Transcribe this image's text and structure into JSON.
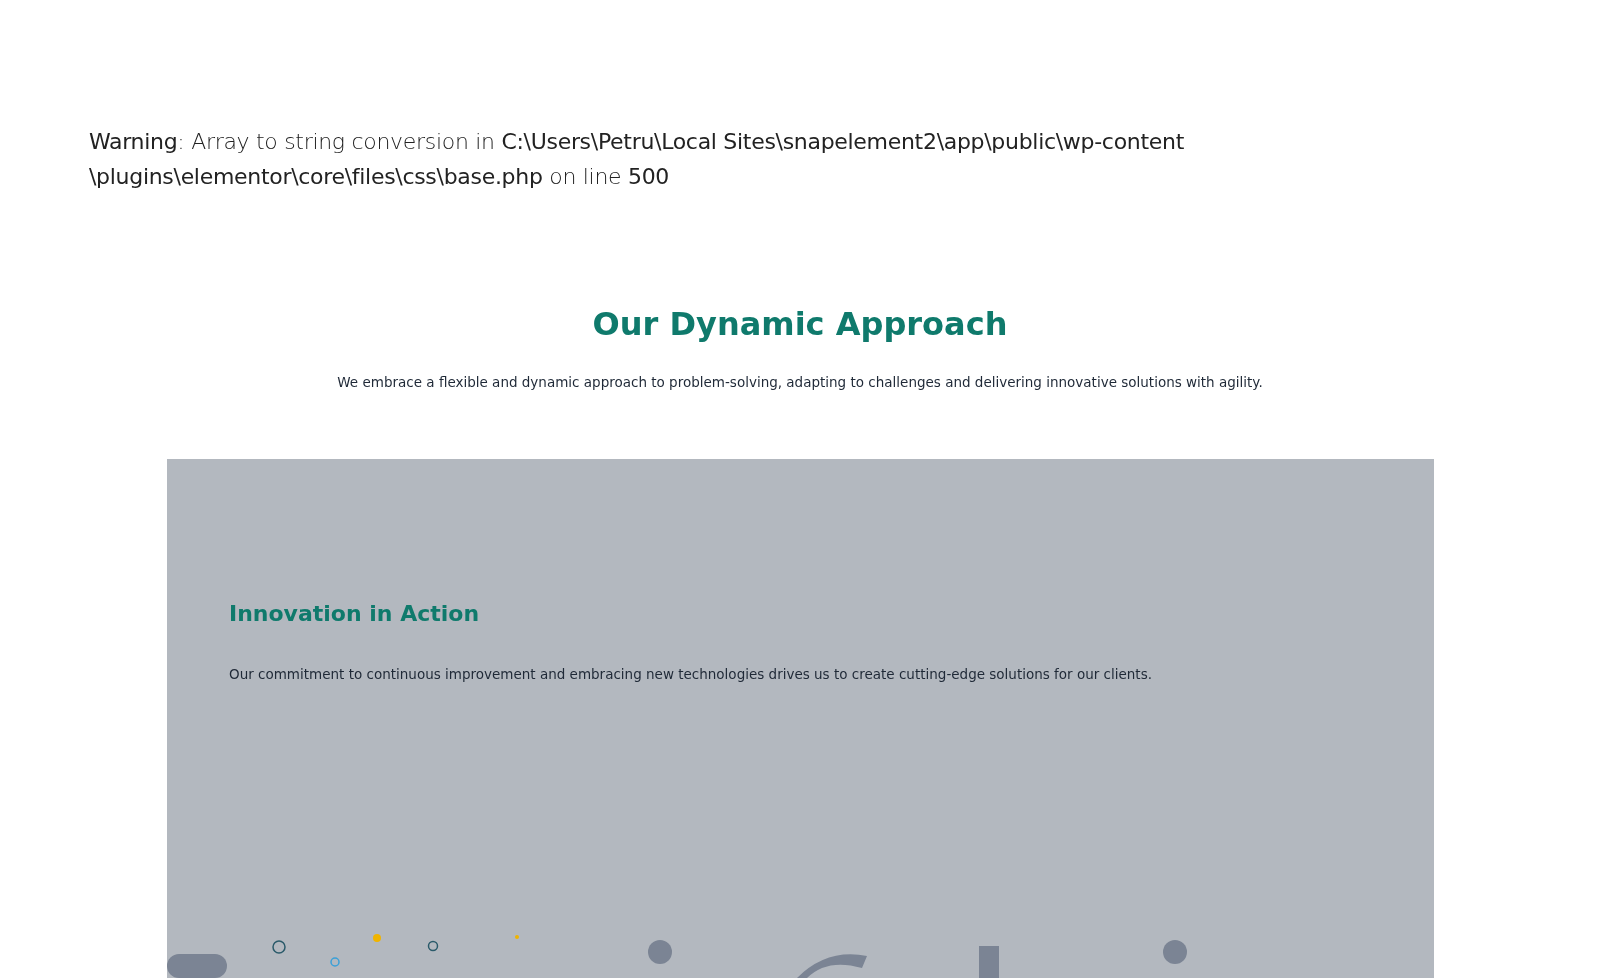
{
  "warning": "**Warning**: Array to string conversion in **C:\\Users\\Petru\\Local Sites\\snapelement2\\app\\public\\wp-content\\plugins\\elementor\\core\\files\\css\\base.php** on line **500**",
  "section": {
    "title": "Our Dynamic Approach",
    "subtitle": "We embrace a flexible and dynamic approach to problem-solving, adapting to challenges and delivering innovative solutions with agility."
  },
  "feature": {
    "title": "Innovation in Action",
    "body": "Our commitment to continuous improvement and embracing new technologies drives us to create cutting-edge solutions for our clients."
  }
}
